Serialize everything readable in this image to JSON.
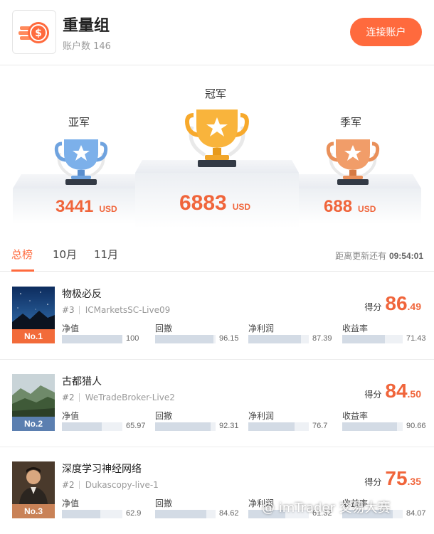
{
  "header": {
    "title": "重量组",
    "count_label": "账户数 146",
    "connect_button": "连接账户"
  },
  "podium": {
    "first": {
      "label": "冠军",
      "amount": "6883",
      "currency": "USD"
    },
    "second": {
      "label": "亚军",
      "amount": "3441",
      "currency": "USD"
    },
    "third": {
      "label": "季军",
      "amount": "688",
      "currency": "USD"
    }
  },
  "tabs": {
    "items": [
      "总榜",
      "10月",
      "11月"
    ],
    "active": "总榜",
    "countdown_label": "距离更新还有",
    "countdown_value": "09:54:01"
  },
  "metric_labels": [
    "净值",
    "回撤",
    "净利润",
    "收益率"
  ],
  "score_label": "得分",
  "rows": [
    {
      "rank": "No.1",
      "name": "物极必反",
      "sub_rank": "#3",
      "account": "ICMarketsSC-Live09",
      "score_int": "86",
      "score_dec": ".49",
      "metrics": [
        {
          "value": "100",
          "level": 1.0
        },
        {
          "value": "96.15",
          "level": 0.96
        },
        {
          "value": "87.39",
          "level": 0.87
        },
        {
          "value": "71.43",
          "level": 0.71
        }
      ],
      "badge_color": "#f26b3a"
    },
    {
      "rank": "No.2",
      "name": "古都猎人",
      "sub_rank": "#2",
      "account": "WeTradeBroker-Live2",
      "score_int": "84",
      "score_dec": ".50",
      "metrics": [
        {
          "value": "65.97",
          "level": 0.66
        },
        {
          "value": "92.31",
          "level": 0.92
        },
        {
          "value": "76.7",
          "level": 0.77
        },
        {
          "value": "90.66",
          "level": 0.91
        }
      ],
      "badge_color": "#5b7fb0"
    },
    {
      "rank": "No.3",
      "name": "深度学习神经网络",
      "sub_rank": "#2",
      "account": "Dukascopy-live-1",
      "score_int": "75",
      "score_dec": ".35",
      "metrics": [
        {
          "value": "62.9",
          "level": 0.63
        },
        {
          "value": "84.62",
          "level": 0.85
        },
        {
          "value": "61.32",
          "level": 0.61
        },
        {
          "value": "84.07",
          "level": 0.84
        }
      ],
      "badge_color": "#c98257"
    }
  ],
  "watermark": "@ imTrader 交易大赛",
  "colors": {
    "accent": "#ff6a3d",
    "gold": "#f7a92c",
    "silver": "#6fa3df",
    "bronze": "#e9905a"
  }
}
